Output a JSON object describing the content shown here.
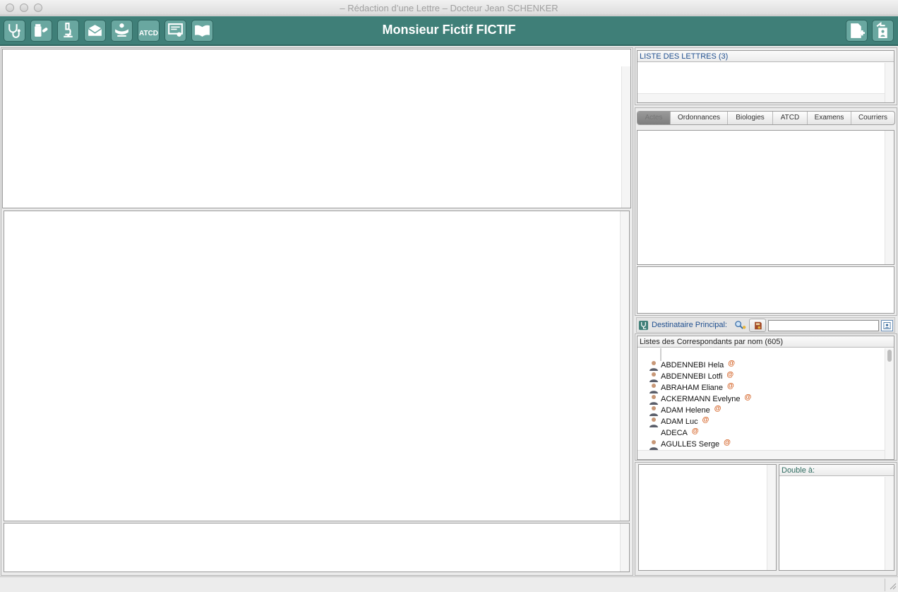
{
  "window": {
    "title": "– Rédaction d’une Lettre – Docteur Jean SCHENKER"
  },
  "toolbar": {
    "patient_name": "Monsieur Fictif FICTIF",
    "buttons": [
      {
        "icon": "stethoscope-icon"
      },
      {
        "icon": "medication-icon"
      },
      {
        "icon": "microscope-icon"
      },
      {
        "icon": "envelope-icon"
      },
      {
        "icon": "specialist-icon"
      },
      {
        "icon": "atcd-icon",
        "label": "ATCD"
      },
      {
        "icon": "certificate-icon"
      },
      {
        "icon": "book-icon"
      }
    ],
    "right_buttons": [
      {
        "icon": "new-document-icon"
      },
      {
        "icon": "patient-return-icon"
      }
    ]
  },
  "letters": {
    "header": "LISTE DES LETTRES (3)"
  },
  "tabs": [
    {
      "label": "Actes",
      "active": true
    },
    {
      "label": "Ordonnances"
    },
    {
      "label": "Biologies"
    },
    {
      "label": "ATCD"
    },
    {
      "label": "Examens"
    },
    {
      "label": "Courriers"
    }
  ],
  "destinataire": {
    "label": "Destinataire Principal:",
    "search_value": ""
  },
  "correspondants": {
    "header": "Listes des Correspondants par nom (605)",
    "items": [
      {
        "name": "ABDENNEBI Hela",
        "person": true
      },
      {
        "name": "ABDENNEBI Lotfi",
        "person": true
      },
      {
        "name": "ABRAHAM Eliane",
        "person": true
      },
      {
        "name": "ACKERMANN Evelyne",
        "person": true
      },
      {
        "name": "ADAM Helene",
        "person": true
      },
      {
        "name": "ADAM Luc",
        "person": true
      },
      {
        "name": "ADECA",
        "person": false
      },
      {
        "name": "AGULLES Serge",
        "person": true
      }
    ],
    "email_marker": "@"
  },
  "double": {
    "header": "Double à:"
  },
  "colors": {
    "toolbar": "#3f7f78",
    "button": "#69a7a0",
    "link_blue": "#1f4f8f",
    "email_orange": "#d25a1a"
  }
}
